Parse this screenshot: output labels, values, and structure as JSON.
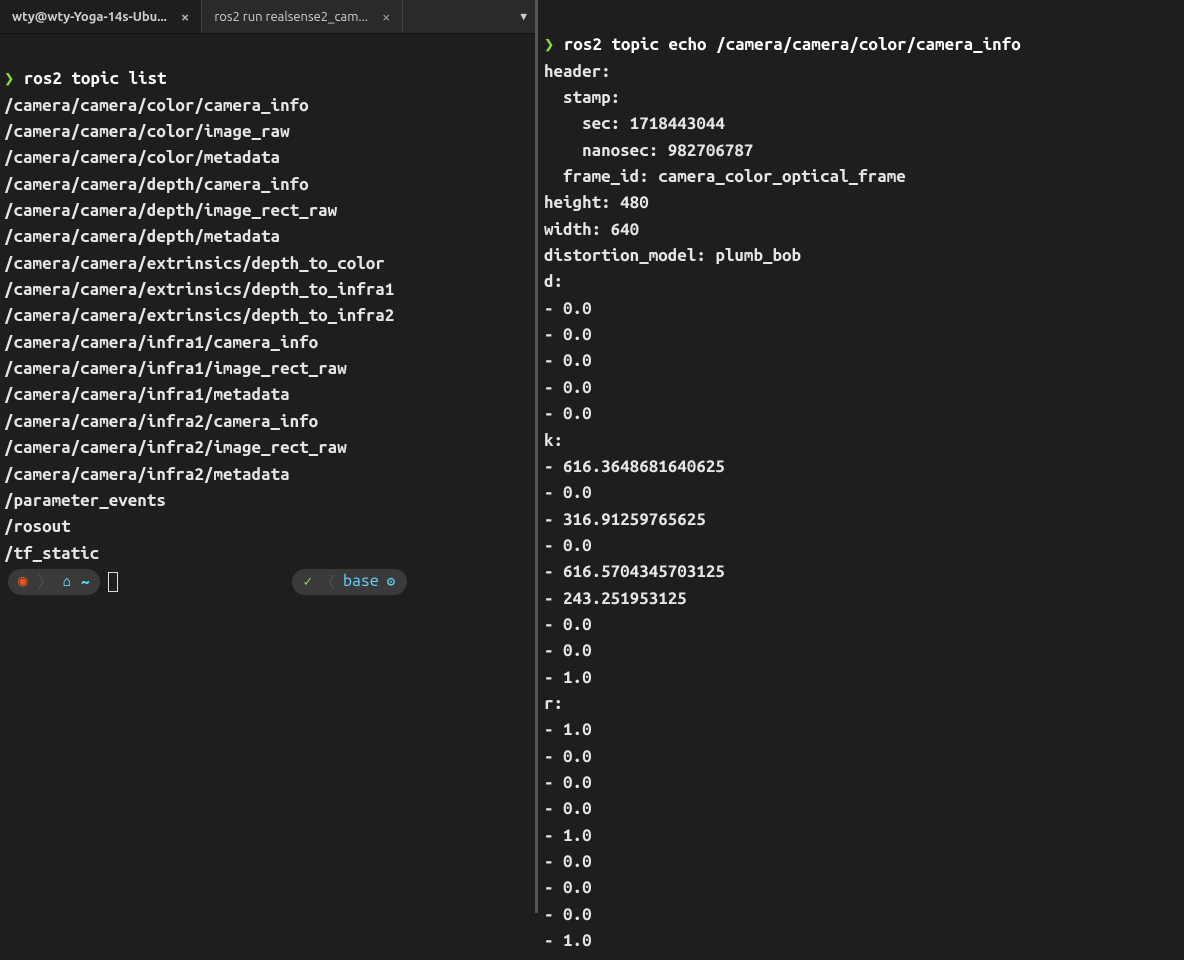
{
  "tabs": {
    "tab1": {
      "label": "wty@wty-Yoga-14s-Ubu..."
    },
    "tab2": {
      "label": "ros2 run realsense2_cam..."
    }
  },
  "left": {
    "prompt": "❯",
    "command": "ros2 topic list",
    "topics": [
      "/camera/camera/color/camera_info",
      "/camera/camera/color/image_raw",
      "/camera/camera/color/metadata",
      "/camera/camera/depth/camera_info",
      "/camera/camera/depth/image_rect_raw",
      "/camera/camera/depth/metadata",
      "/camera/camera/extrinsics/depth_to_color",
      "/camera/camera/extrinsics/depth_to_infra1",
      "/camera/camera/extrinsics/depth_to_infra2",
      "/camera/camera/infra1/camera_info",
      "/camera/camera/infra1/image_rect_raw",
      "/camera/camera/infra1/metadata",
      "/camera/camera/infra2/camera_info",
      "/camera/camera/infra2/image_rect_raw",
      "/camera/camera/infra2/metadata",
      "/parameter_events",
      "/rosout",
      "/tf_static"
    ],
    "status": {
      "env": "base"
    }
  },
  "right": {
    "prompt": "❯",
    "command": "ros2 topic echo /camera/camera/color/camera_info",
    "lines": [
      "header:",
      "  stamp:",
      "    sec: 1718443044",
      "    nanosec: 982706787",
      "  frame_id: camera_color_optical_frame",
      "height: 480",
      "width: 640",
      "distortion_model: plumb_bob",
      "d:",
      "- 0.0",
      "- 0.0",
      "- 0.0",
      "- 0.0",
      "- 0.0",
      "k:",
      "- 616.3648681640625",
      "- 0.0",
      "- 316.91259765625",
      "- 0.0",
      "- 616.5704345703125",
      "- 243.251953125",
      "- 0.0",
      "- 0.0",
      "- 1.0",
      "r:",
      "- 1.0",
      "- 0.0",
      "- 0.0",
      "- 0.0",
      "- 1.0",
      "- 0.0",
      "- 0.0",
      "- 0.0",
      "- 1.0"
    ]
  }
}
